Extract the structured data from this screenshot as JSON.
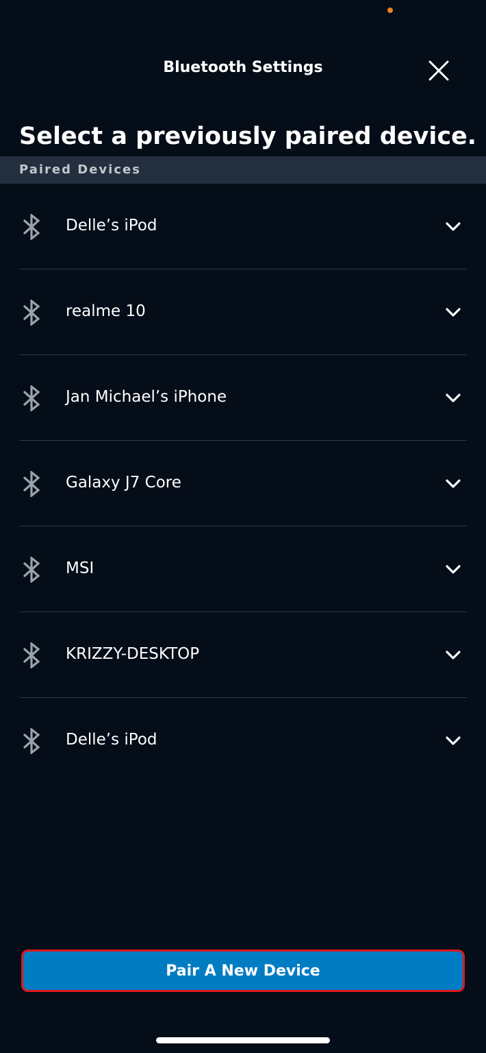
{
  "colors": {
    "background": "#050d18",
    "section_bar": "#232f3e",
    "accent_blue": "#007cc3",
    "highlight_red": "#e0161e",
    "status_dot": "#e8841a"
  },
  "header": {
    "title": "Bluetooth Settings",
    "close_icon": "close-icon"
  },
  "heading": "Select a previously paired device.",
  "section": {
    "label": "Paired Devices"
  },
  "devices": [
    {
      "name": "Delle’s iPod",
      "icon": "bluetooth-icon"
    },
    {
      "name": "realme 10",
      "icon": "bluetooth-icon"
    },
    {
      "name": "Jan Michael’s iPhone",
      "icon": "bluetooth-icon"
    },
    {
      "name": "Galaxy J7 Core",
      "icon": "bluetooth-icon"
    },
    {
      "name": "MSI",
      "icon": "bluetooth-icon"
    },
    {
      "name": "KRIZZY-DESKTOP",
      "icon": "bluetooth-icon"
    },
    {
      "name": "Delle’s iPod",
      "icon": "bluetooth-icon"
    }
  ],
  "footer": {
    "pair_button_label": "Pair A New Device"
  }
}
